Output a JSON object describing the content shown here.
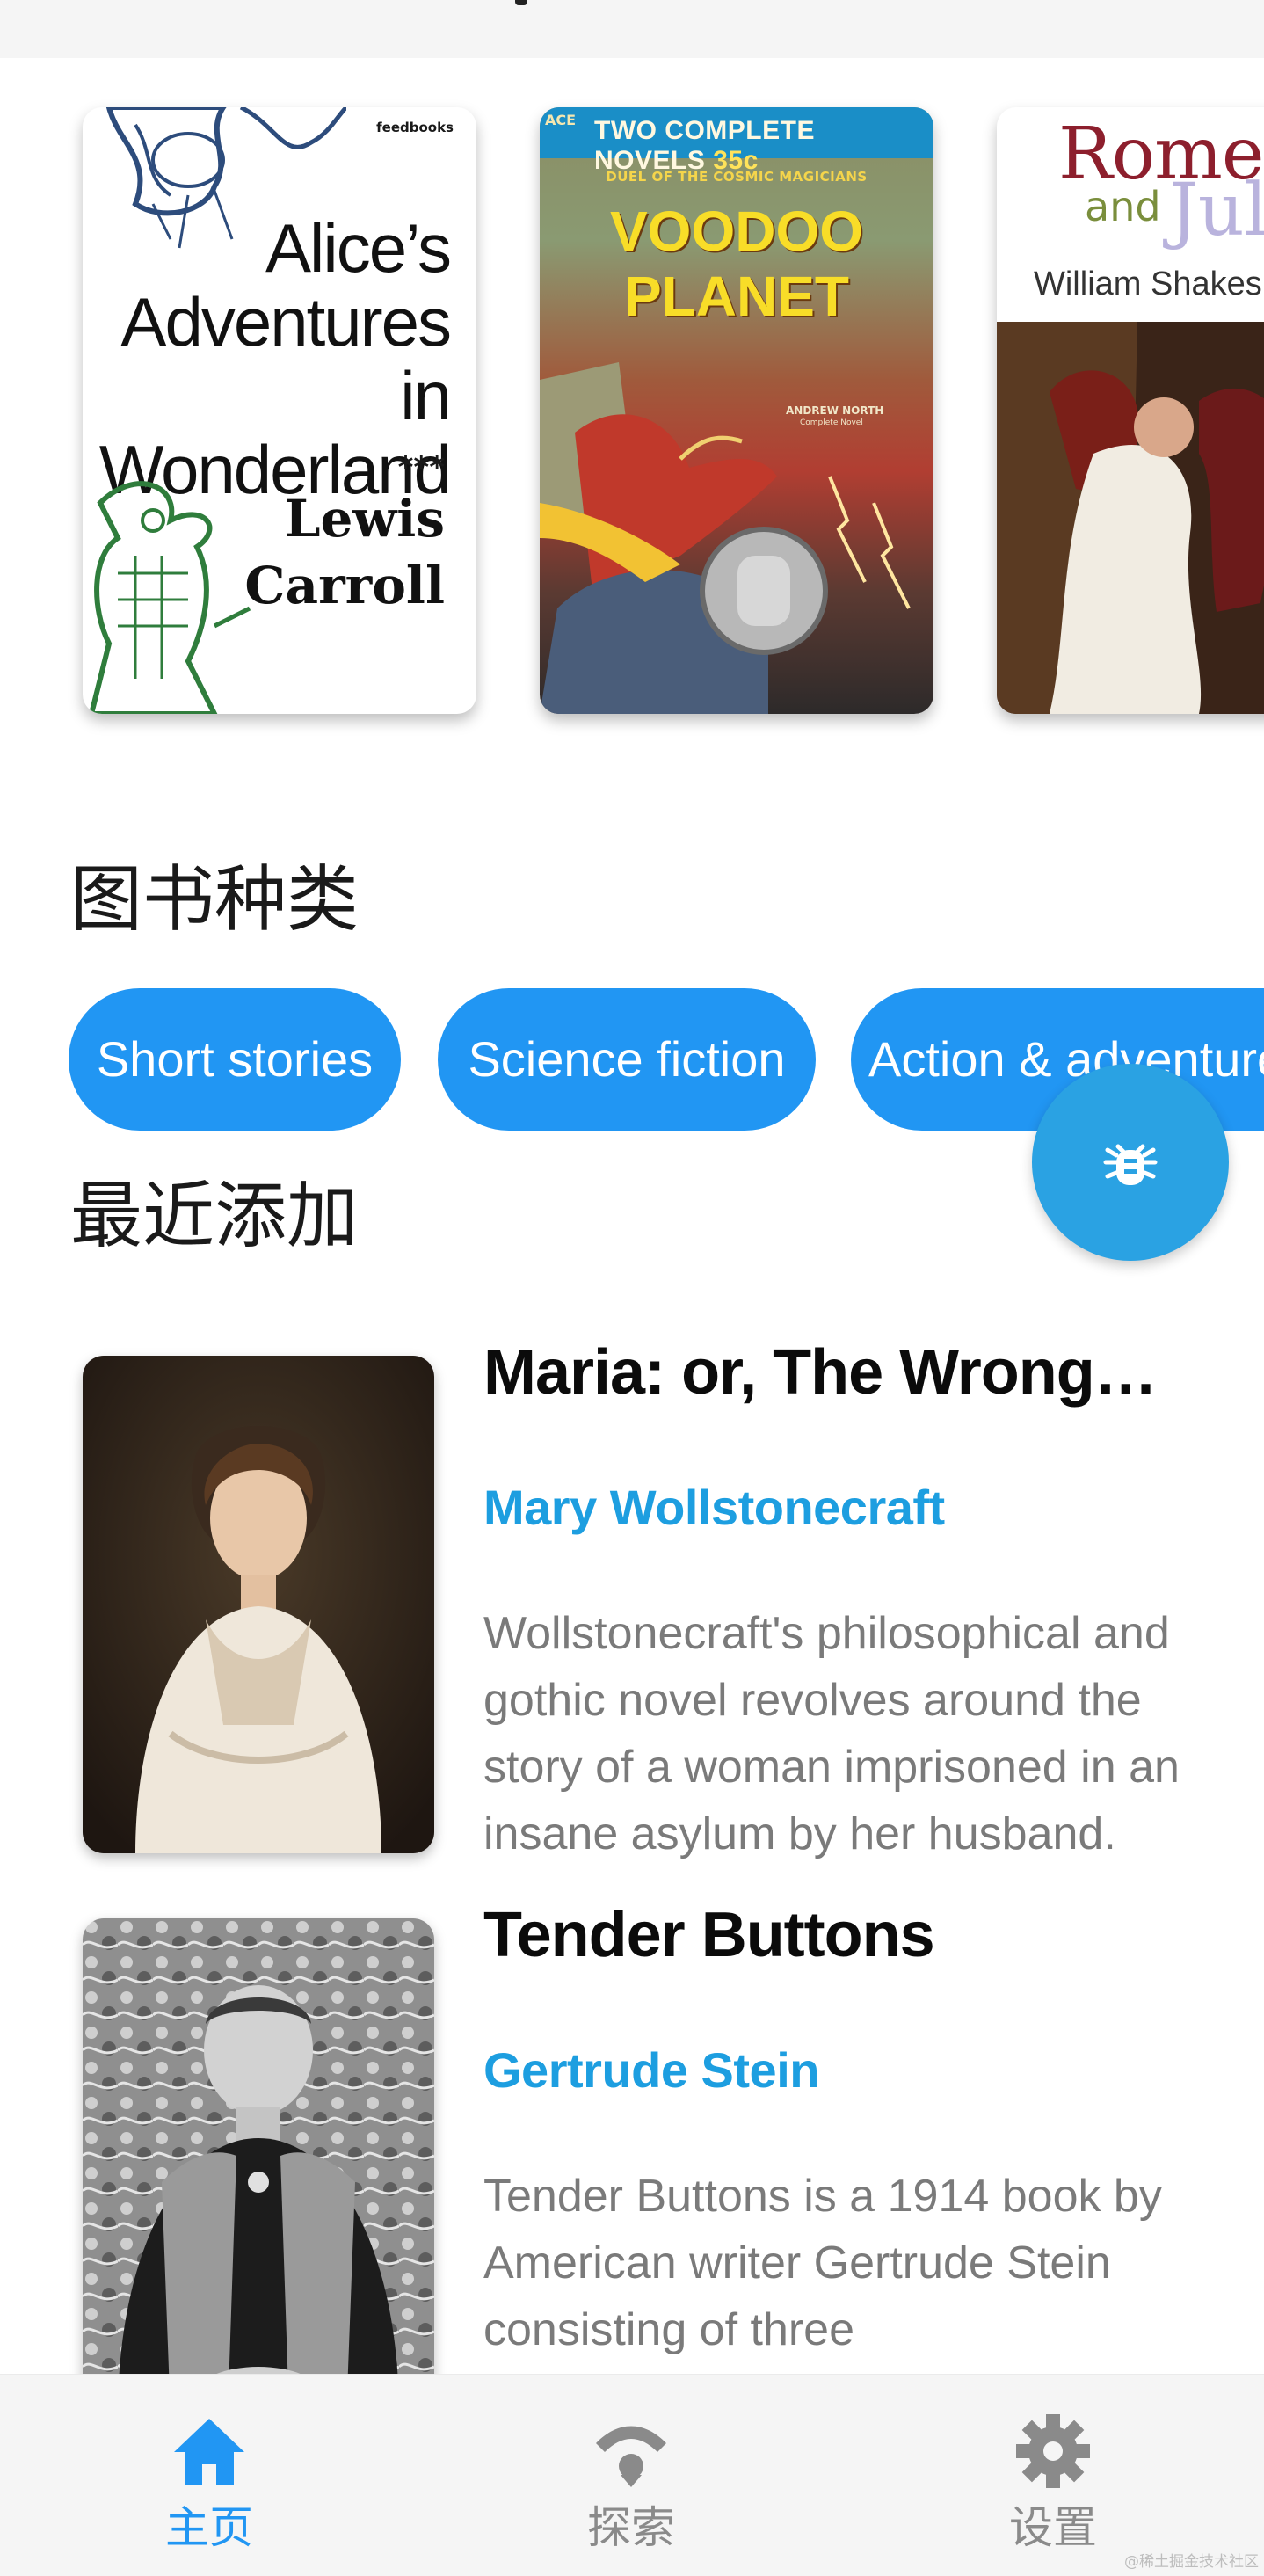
{
  "carousel": {
    "covers": [
      {
        "publisher": "feedbooks",
        "title_lines": [
          "Alice’s",
          "Adventures in",
          "Wonderland"
        ],
        "stars": "***",
        "author_lines": [
          "Lewis",
          "Carroll"
        ]
      },
      {
        "series": "ACE",
        "band_text": "TWO COMPLETE NOVELS",
        "price": "35c",
        "tagline": "DUEL OF THE COSMIC MAGICIANS",
        "title_lines": [
          "VOODOO",
          "PLANET"
        ],
        "byline": "ANDREW NORTH",
        "byline_sub": "Complete Novel"
      },
      {
        "title_top": "Romeo",
        "title_and": "and",
        "title_bottom": "Juliet",
        "author": "William Shakespeare"
      }
    ]
  },
  "genres": {
    "heading": "图书种类",
    "chips": [
      "Short stories",
      "Science fiction",
      "Action & adventure"
    ]
  },
  "fab": {
    "icon": "bug-icon"
  },
  "recent": {
    "heading": "最近添加",
    "books": [
      {
        "title": "Maria: or, The Wrongs of Woman",
        "author": "Mary Wollstonecraft",
        "description": "Wollstonecraft's philosophical and gothic novel revolves around the story of a woman imprisoned in an insane asylum by her husband."
      },
      {
        "title": "Tender Buttons",
        "author": "Gertrude Stein",
        "description": "Tender Buttons is a 1914 book by American writer Gertrude Stein consisting of three"
      }
    ]
  },
  "bottom_nav": {
    "items": [
      {
        "label": "主页",
        "icon": "home-icon",
        "active": true
      },
      {
        "label": "探索",
        "icon": "wifi-icon",
        "active": false
      },
      {
        "label": "设置",
        "icon": "gear-icon",
        "active": false
      }
    ]
  },
  "watermark": "@稀土掘金技术社区",
  "colors": {
    "accent": "#2196f3",
    "author_link": "#1d9ee0",
    "fab": "#2aa2e3",
    "nav_inactive": "#8a8a8a"
  }
}
